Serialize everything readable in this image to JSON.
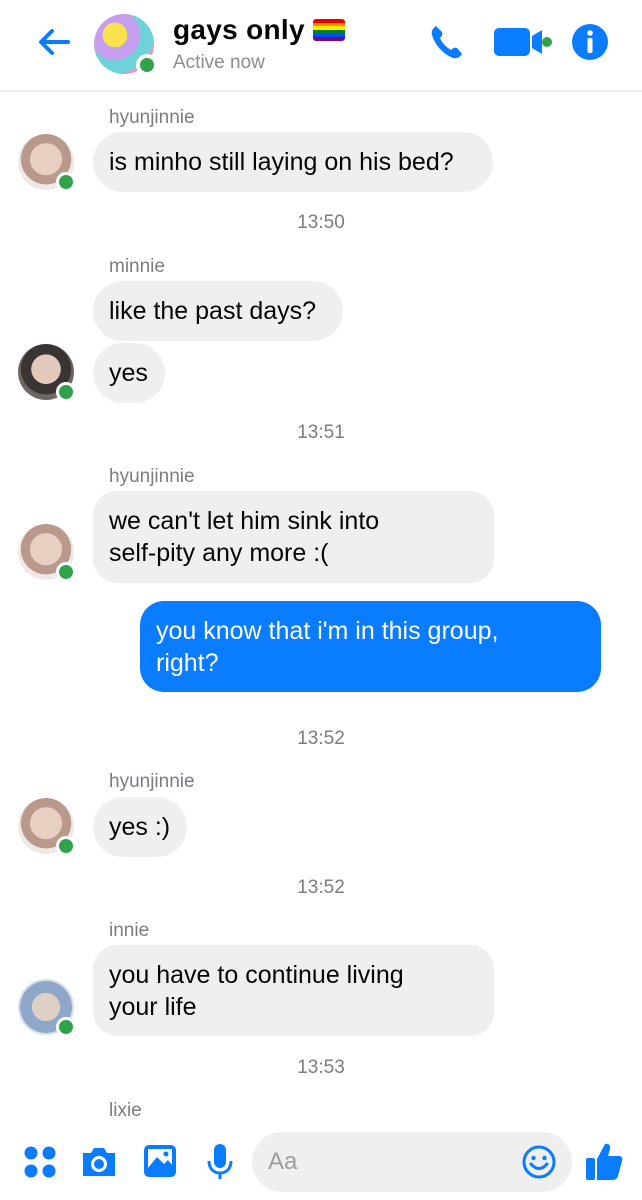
{
  "header": {
    "title": "gays only",
    "status": "Active now"
  },
  "messages": [
    {
      "sender": "hyunjinnie",
      "text": "is minho still laying on his bed?"
    },
    {
      "time": "13:50"
    },
    {
      "sender": "minnie",
      "text1": "like the past days?",
      "text2": "yes"
    },
    {
      "time": "13:51"
    },
    {
      "sender": "hyunjinnie",
      "line1": "we can't let him sink into",
      "line2": "self-pity any more :("
    },
    {
      "me_line1": "you know that i'm in this group,",
      "me_line2": "right?"
    },
    {
      "time": "13:52"
    },
    {
      "sender": "hyunjinnie",
      "text": "yes :)"
    },
    {
      "time": "13:52"
    },
    {
      "sender": "innie",
      "line1": "you have to continue living",
      "line2": "your life"
    },
    {
      "time": "13:53"
    },
    {
      "sender": "lixie"
    }
  ],
  "composer": {
    "placeholder": "Aa"
  },
  "colors": {
    "accent": "#0a7cff",
    "online": "#31a24c",
    "bubble": "#efefef"
  },
  "icons": [
    "back-arrow-icon",
    "phone-icon",
    "video-icon",
    "info-icon",
    "apps-icon",
    "camera-icon",
    "gallery-icon",
    "mic-icon",
    "emoji-icon",
    "thumbs-up-icon"
  ]
}
